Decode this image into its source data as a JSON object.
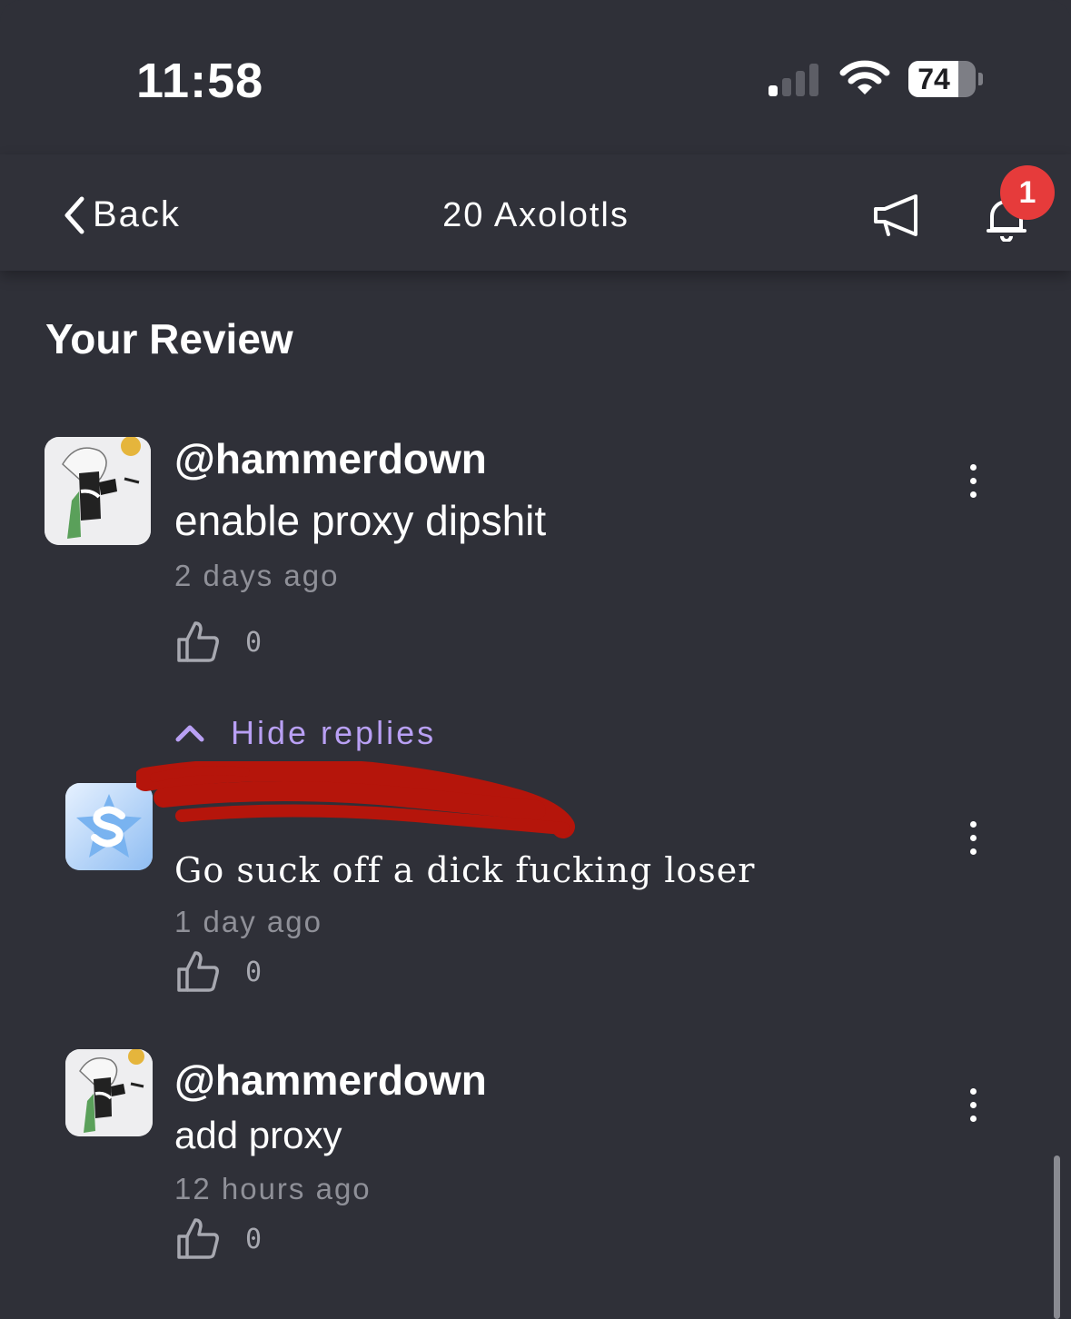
{
  "status_bar": {
    "time": "11:58",
    "battery": "74",
    "battery_level": 0.74
  },
  "nav": {
    "back_label": "Back",
    "title": "20 Axolotls",
    "notification_count": "1"
  },
  "section_title": "Your Review",
  "review": {
    "user": "@hammerdown",
    "text": "enable proxy dipshit",
    "time": "2 days ago",
    "likes": "0"
  },
  "replies_toggle": "Hide replies",
  "replies": [
    {
      "user": "",
      "text": "Go suck off a dick fucking loser",
      "time": "1 day ago",
      "likes": "0"
    },
    {
      "user": "@hammerdown",
      "text": "add proxy",
      "time": "12 hours ago",
      "likes": "0"
    }
  ],
  "colors": {
    "background": "#2f3038",
    "accent": "#b9a0f4",
    "badge": "#e63b3b",
    "muted": "#8f9098"
  },
  "icons": [
    "back-chevron-icon",
    "megaphone-icon",
    "bell-icon",
    "thumbs-up-icon",
    "more-vertical-icon",
    "chevron-up-icon",
    "wifi-icon",
    "signal-icon"
  ]
}
